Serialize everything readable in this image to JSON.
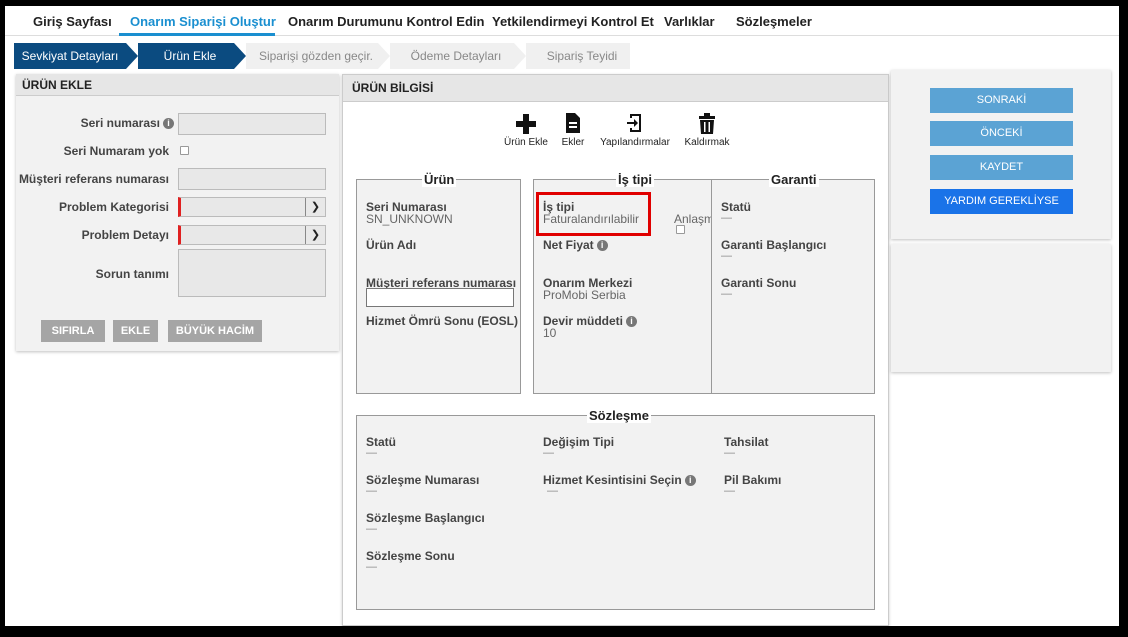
{
  "nav": {
    "items": [
      "Giriş Sayfası",
      "Onarım Siparişi Oluştur",
      "Onarım Durumunu Kontrol Edin",
      "Yetkilendirmeyi Kontrol Et",
      "Varlıklar",
      "Sözleşmeler"
    ],
    "active": "Onarım Siparişi Oluştur"
  },
  "steps": [
    {
      "label": "Sevkiyat Detayları",
      "state": "done"
    },
    {
      "label": "Ürün Ekle",
      "state": "done"
    },
    {
      "label": "Siparişi gözden geçir.",
      "state": "todo"
    },
    {
      "label": "Ödeme Detayları",
      "state": "todo"
    },
    {
      "label": "Sipariş Teyidi",
      "state": "todo"
    }
  ],
  "add_product": {
    "title": "ÜRÜN EKLE",
    "serial_label": "Seri numarası",
    "no_serial_label": "Seri Numaram yok",
    "customer_ref_label": "Müşteri referans numarası",
    "problem_category_label": "Problem Kategorisi",
    "problem_detail_label": "Problem Detayı",
    "issue_description_label": "Sorun tanımı",
    "reset_button": "SIFIRLA",
    "add_button": "EKLE",
    "bulk_button": "BÜYÜK HACİM"
  },
  "product_info": {
    "title": "ÜRÜN BİLGİSİ",
    "tools": {
      "add_product": "Ürün Ekle",
      "attachments": "Ekler",
      "configurations": "Yapılandırmalar",
      "remove": "Kaldırmak"
    },
    "product": {
      "legend": "Ürün",
      "serial_label": "Seri Numarası",
      "serial_value": "SN_UNKNOWN",
      "name_label": "Ürün Adı",
      "customer_ref_label": "Müşteri referans numarası",
      "eosl_label": "Hizmet Ömrü Sonu (EOSL)"
    },
    "job_type": {
      "legend": "İş tipi",
      "type_label": "İş tipi",
      "type_value": "Faturalandırılabilir",
      "agreement_label": "Anlaşm",
      "net_price_label": "Net Fiyat",
      "repair_center_label": "Onarım Merkezi",
      "repair_center_value": "ProMobi Serbia",
      "turnaround_label": "Devir müddeti",
      "turnaround_value": "10"
    },
    "warranty": {
      "legend": "Garanti",
      "status_label": "Statü",
      "status_value": "—",
      "start_label": "Garanti Başlangıcı",
      "start_value": "—",
      "end_label": "Garanti Sonu",
      "end_value": "—"
    },
    "contract": {
      "legend": "Sözleşme",
      "status_label": "Statü",
      "status_value": "—",
      "number_label": "Sözleşme Numarası",
      "number_value": "—",
      "start_label": "Sözleşme Başlangıcı",
      "start_value": "—",
      "end_label": "Sözleşme Sonu",
      "end_value": "—",
      "exchange_label": "Değişim Tipi",
      "exchange_value": "—",
      "service_outage_label": "Hizmet Kesintisini Seçin",
      "service_outage_value": "—",
      "collection_label": "Tahsilat",
      "collection_value": "—",
      "battery_label": "Pil Bakımı",
      "battery_value": "—"
    }
  },
  "actions": {
    "next": "SONRAKİ",
    "previous": "ÖNCEKİ",
    "save": "KAYDET",
    "help": "YARDIM GEREKLİYSE"
  },
  "colors": {
    "nav_active": "#1a8fd0",
    "step_done": "#0b4b80",
    "action_button": "#5ba3d4",
    "help_button": "#1a73e8",
    "highlight": "#e00000"
  }
}
